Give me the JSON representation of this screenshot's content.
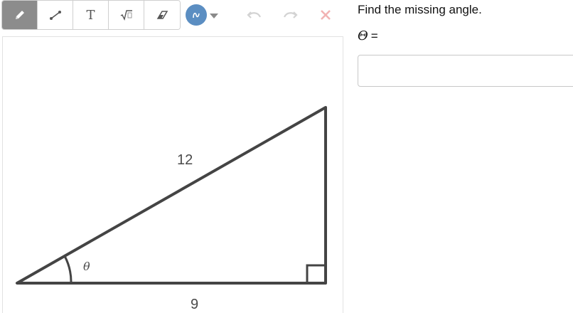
{
  "toolbar": {
    "tools": [
      {
        "name": "pencil",
        "icon": "pencil-icon"
      },
      {
        "name": "line",
        "icon": "line-segment-icon"
      },
      {
        "name": "text",
        "icon": "text-icon",
        "glyph": "T"
      },
      {
        "name": "math",
        "icon": "square-root-icon"
      },
      {
        "name": "eraser",
        "icon": "eraser-icon"
      }
    ],
    "active_tool": "pencil",
    "color_picker": {
      "icon": "color-swatch-icon",
      "color": "#5b8ec2"
    },
    "undo": {
      "icon": "undo-icon"
    },
    "redo": {
      "icon": "redo-icon"
    },
    "clear": {
      "icon": "close-icon",
      "color": "#f2b3b3"
    }
  },
  "figure": {
    "hypotenuse_label": "12",
    "base_label": "9",
    "angle_label": "θ"
  },
  "question": {
    "prompt": "Find the missing angle.",
    "answer_symbol": "Θ",
    "answer_equals": "=",
    "answer_value": ""
  }
}
